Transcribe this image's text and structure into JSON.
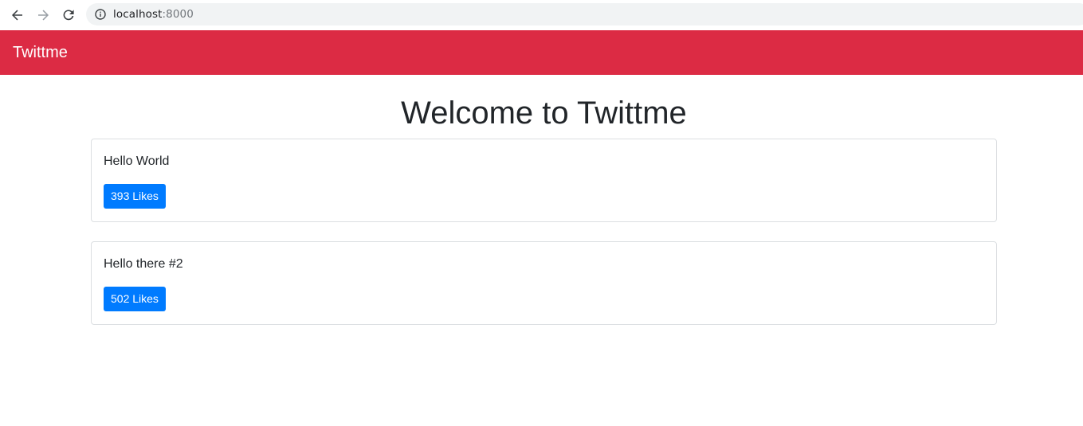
{
  "browser": {
    "url_host": "localhost",
    "url_port": ":8000",
    "icons": {
      "back": "arrow-left-icon",
      "forward": "arrow-right-icon",
      "reload": "reload-icon",
      "info": "info-icon"
    }
  },
  "navbar": {
    "brand": "Twittme",
    "color": "#dc2b44"
  },
  "main": {
    "title": "Welcome to Twittme",
    "tweets": [
      {
        "text": "Hello World",
        "likes_label": "393 Likes"
      },
      {
        "text": "Hello there #2",
        "likes_label": "502 Likes"
      }
    ],
    "button_color": "#007bff"
  }
}
